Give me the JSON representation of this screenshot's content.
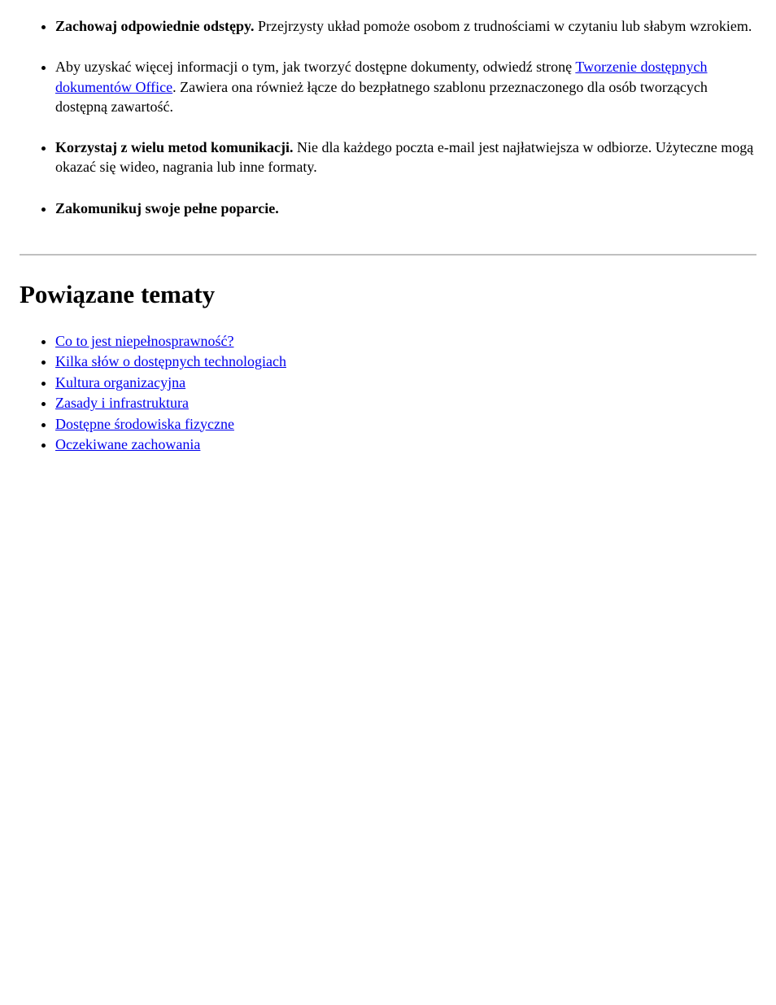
{
  "items": [
    {
      "prefix": "",
      "bold": "Zachowaj odpowiednie odstępy.",
      "tail": " Przejrzysty układ pomoże osobom z trudnościami w czytaniu lub słabym wzrokiem."
    },
    {
      "prefix": "Aby uzyskać więcej informacji o tym, jak tworzyć dostępne dokumenty, odwiedź stronę ",
      "link": "Tworzenie dostępnych dokumentów Office",
      "after_link": ". Zawiera ona również łącze do bezpłatnego szablonu przeznaczonego dla osób tworzących dostępną zawartość."
    },
    {
      "prefix": "",
      "bold": "Korzystaj z wielu metod komunikacji.",
      "tail": " Nie dla każdego poczta e-mail jest najłatwiejsza w odbiorze. Użyteczne mogą okazać się wideo, nagrania lub inne formaty."
    },
    {
      "prefix": "",
      "bold": "Zakomunikuj swoje pełne poparcie.",
      "tail": ""
    }
  ],
  "section_heading": "Powiązane tematy",
  "links": [
    "Co to jest niepełnosprawność?",
    "Kilka słów o dostępnych technologiach",
    "Kultura organizacyjna",
    "Zasady i infrastruktura",
    "Dostępne środowiska fizyczne",
    "Oczekiwane zachowania"
  ]
}
